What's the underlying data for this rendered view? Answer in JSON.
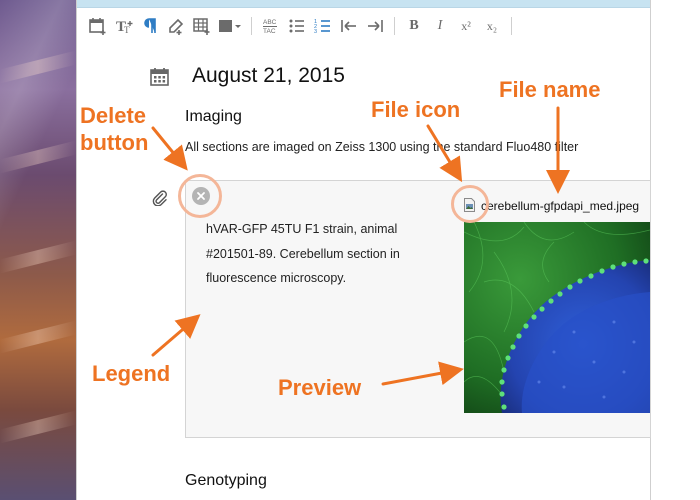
{
  "colors": {
    "annotation": "#ee7322",
    "annotation_ring": "#f4b698",
    "toolbar_accent": "#2f7dc4"
  },
  "toolbar": {
    "items": [
      {
        "icon": "add-date-icon"
      },
      {
        "icon": "text-size-icon"
      },
      {
        "icon": "paragraph-icon"
      },
      {
        "icon": "sign-icon"
      },
      {
        "icon": "add-table-icon"
      },
      {
        "icon": "color-square-icon"
      },
      {
        "icon": "spellcheck-icon"
      },
      {
        "icon": "bullet-list-icon"
      },
      {
        "icon": "numbered-list-icon"
      },
      {
        "icon": "outdent-icon"
      },
      {
        "icon": "indent-icon"
      },
      {
        "icon": "bold-icon",
        "glyph": "B"
      },
      {
        "icon": "italic-icon",
        "glyph": "I"
      },
      {
        "icon": "superscript-icon",
        "glyph": "x²"
      },
      {
        "icon": "subscript-icon",
        "glyph": "x₂"
      }
    ]
  },
  "entry": {
    "date": "August 21, 2015",
    "section_title": "Imaging",
    "section_text": "All sections are imaged on Zeiss 1300 using the standard Fluo480 filter",
    "attachment": {
      "legend": "hVAR-GFP 45TU F1 strain, animal #201501-89. Cerebellum section in fluorescence microscopy.",
      "file_name": "cerebellum-gfpdapi_med.jpeg"
    },
    "next_section_title": "Genotyping"
  },
  "annotations": {
    "delete": "Delete\nbutton",
    "file_icon": "File icon",
    "file_name": "File name",
    "legend": "Legend",
    "preview": "Preview"
  }
}
